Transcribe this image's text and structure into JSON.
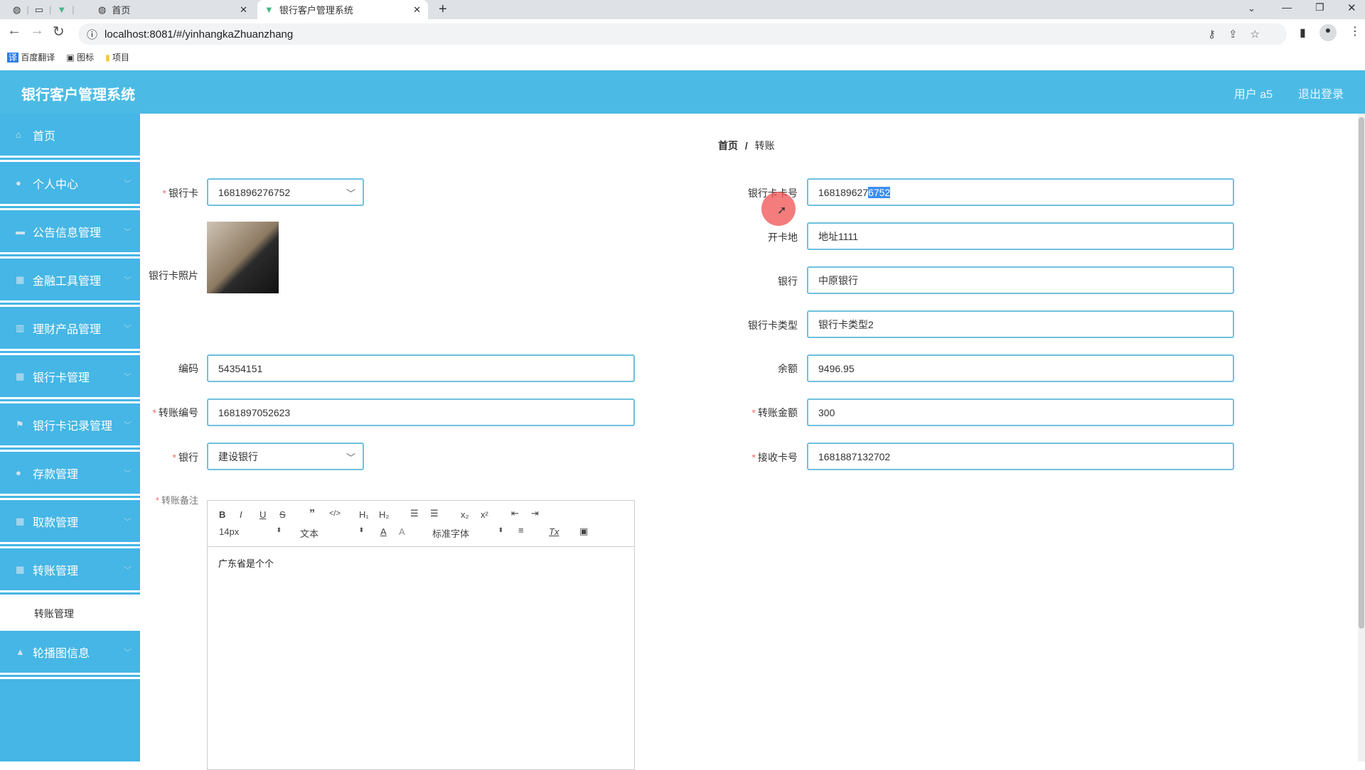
{
  "browser": {
    "tabs": [
      {
        "label": "首页"
      },
      {
        "label": "银行客户管理系统"
      }
    ],
    "url": "localhost:8081/#/yinhangkaZhuanzhang",
    "bookmarks": [
      "百度翻译",
      "图标",
      "项目"
    ]
  },
  "header": {
    "title": "银行客户管理系统",
    "user": "用户 a5",
    "logout": "退出登录"
  },
  "sidebar": {
    "items": [
      {
        "label": "首页",
        "icon": "home-icon"
      },
      {
        "label": "个人中心",
        "icon": "user-icon"
      },
      {
        "label": "公告信息管理",
        "icon": "notice-icon"
      },
      {
        "label": "金融工具管理",
        "icon": "grid-icon"
      },
      {
        "label": "理财产品管理",
        "icon": "chart-icon"
      },
      {
        "label": "银行卡管理",
        "icon": "grid-icon"
      },
      {
        "label": "银行卡记录管理",
        "icon": "flag-icon"
      },
      {
        "label": "存款管理",
        "icon": "user-icon"
      },
      {
        "label": "取款管理",
        "icon": "grid-icon"
      },
      {
        "label": "转账管理",
        "icon": "grid-icon"
      },
      {
        "label": "轮播图信息",
        "icon": "image-icon"
      }
    ],
    "sub_item": "转账管理"
  },
  "breadcrumb": {
    "home": "首页",
    "sep": "/",
    "current": "转账"
  },
  "form": {
    "card_label": "银行卡",
    "card_value": "1681896276752",
    "photo_label": "银行卡照片",
    "code_label": "编码",
    "code_value": "54354151",
    "transfer_no_label": "转账编号",
    "transfer_no_value": "1681897052623",
    "bank_select_label": "银行",
    "bank_select_value": "建设银行",
    "note_label": "转账备注",
    "card_no_label": "银行卡卡号",
    "card_no_value_plain": "168189627",
    "card_no_value_selected": "6752",
    "open_place_label": "开卡地",
    "open_place_value": "地址1111",
    "bank_label": "银行",
    "bank_value": "中原银行",
    "card_type_label": "银行卡类型",
    "card_type_value": "银行卡类型2",
    "balance_label": "余额",
    "balance_value": "9496.95",
    "amount_label": "转账金额",
    "amount_value": "300",
    "receive_label": "接收卡号",
    "receive_value": "1681887132702"
  },
  "editor": {
    "font_size": "14px",
    "header_select": "文本",
    "font_select": "标准字体",
    "content": "广东省是个个"
  }
}
